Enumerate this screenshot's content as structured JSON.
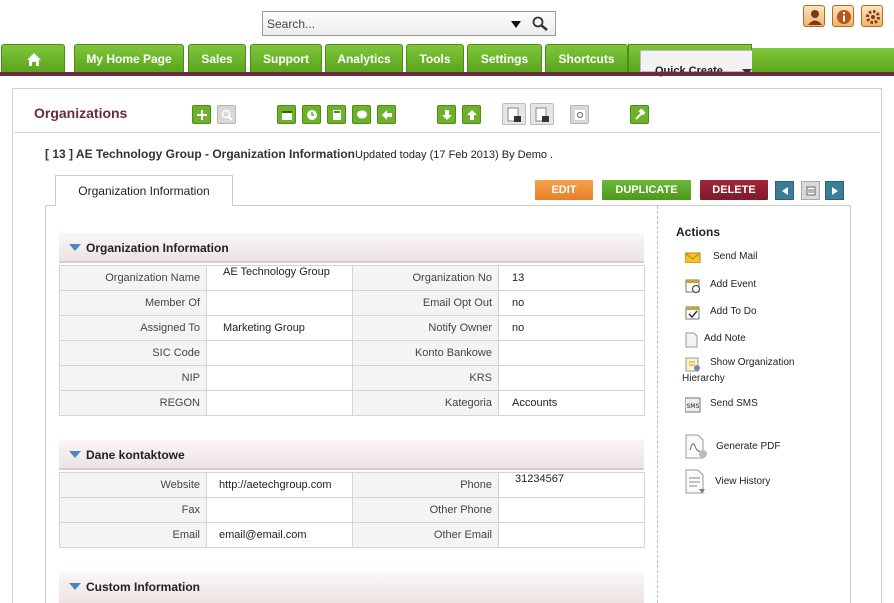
{
  "search": {
    "placeholder": "Search..."
  },
  "nav": {
    "tabs": [
      "My Home Page",
      "Sales",
      "Support",
      "Analytics",
      "Tools",
      "Settings",
      "Shortcuts"
    ],
    "quick_create": "Quick Create..."
  },
  "module": {
    "title": "Organizations"
  },
  "record": {
    "title": "[ 13 ] AE Technology Group - Organization Information",
    "updated": "Updated today (17 Feb 2013) By Demo ."
  },
  "tab_label": "Organization Information",
  "buttons": {
    "edit": "EDIT",
    "duplicate": "DUPLICATE",
    "delete": "DELETE"
  },
  "blocks": {
    "org_info": {
      "title": "Organization Information",
      "rows": [
        {
          "l1": "Organization Name",
          "v1": "AE Technology Group",
          "l2": "Organization No",
          "v2": "13"
        },
        {
          "l1": "Member Of",
          "v1": "",
          "l2": "Email Opt Out",
          "v2": "no"
        },
        {
          "l1": "Assigned To",
          "v1": "Marketing Group",
          "l2": "Notify Owner",
          "v2": "no"
        },
        {
          "l1": "SIC Code",
          "v1": "",
          "l2": "Konto Bankowe",
          "v2": ""
        },
        {
          "l1": "NIP",
          "v1": "",
          "l2": "KRS",
          "v2": ""
        },
        {
          "l1": "REGON",
          "v1": "",
          "l2": "Kategoria",
          "v2": "Accounts"
        }
      ]
    },
    "contact": {
      "title": "Dane kontaktowe",
      "rows": [
        {
          "l1": "Website",
          "v1": "http://aetechgroup.com",
          "l2": "Phone",
          "v2": "31234567"
        },
        {
          "l1": "Fax",
          "v1": "",
          "l2": "Other Phone",
          "v2": ""
        },
        {
          "l1": "Email",
          "v1": "email@email.com",
          "l2": "Other Email",
          "v2": ""
        }
      ]
    },
    "custom": {
      "title": "Custom Information"
    }
  },
  "actions": {
    "title": "Actions",
    "send_mail": "Send Mail",
    "add_event": "Add Event",
    "add_todo": "Add To Do",
    "add_note": "Add Note",
    "show_hierarchy_1": "Show Organization",
    "show_hierarchy_2": "Hierarchy",
    "send_sms": "Send SMS",
    "generate_pdf": "Generate PDF",
    "view_history": "View History"
  },
  "colors": {
    "nav_green": "#6cb52c",
    "accent_maroon": "#6b2a3e",
    "edit_orange": "#e6802a",
    "delete_red": "#7d1a2a"
  }
}
